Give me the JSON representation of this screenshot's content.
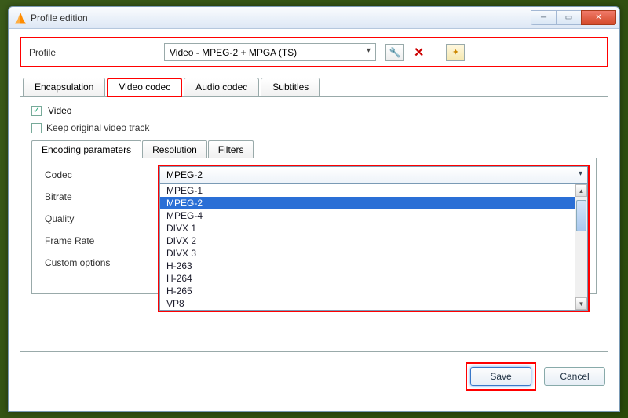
{
  "window": {
    "title": "Profile edition"
  },
  "profile": {
    "label": "Profile",
    "selected": "Video - MPEG-2 + MPGA (TS)"
  },
  "tabs": [
    {
      "label": "Encapsulation"
    },
    {
      "label": "Video codec"
    },
    {
      "label": "Audio codec"
    },
    {
      "label": "Subtitles"
    }
  ],
  "video": {
    "enable_label": "Video",
    "keep_label": "Keep original video track"
  },
  "subtabs": [
    {
      "label": "Encoding parameters"
    },
    {
      "label": "Resolution"
    },
    {
      "label": "Filters"
    }
  ],
  "fields": {
    "codec": "Codec",
    "bitrate": "Bitrate",
    "quality": "Quality",
    "framerate": "Frame Rate",
    "custom": "Custom options"
  },
  "codec": {
    "selected": "MPEG-2",
    "options": [
      "MPEG-1",
      "MPEG-2",
      "MPEG-4",
      "DIVX 1",
      "DIVX 2",
      "DIVX 3",
      "H-263",
      "H-264",
      "H-265",
      "VP8"
    ],
    "highlighted_index": 1
  },
  "buttons": {
    "save": "Save",
    "cancel": "Cancel"
  },
  "icons": {
    "wrench": "🔧",
    "new": "✦"
  }
}
